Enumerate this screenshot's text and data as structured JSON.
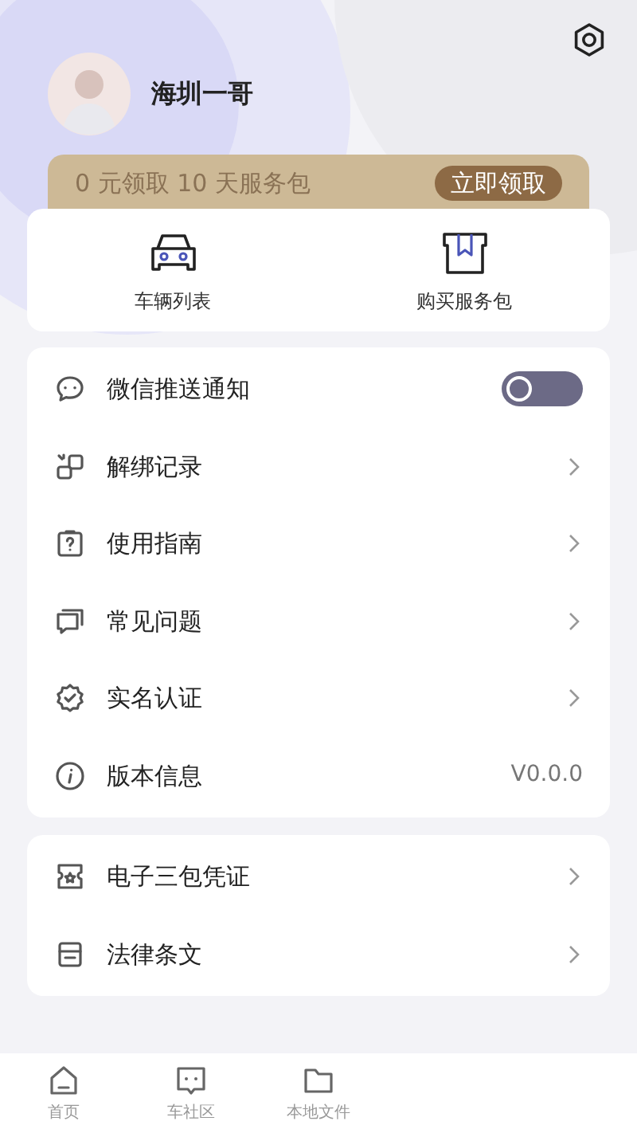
{
  "profile": {
    "name": "海圳一哥"
  },
  "promo": {
    "text": "0 元领取 10 天服务包",
    "button": "立即领取"
  },
  "shortcuts": [
    {
      "kind": "car",
      "label": "车辆列表"
    },
    {
      "kind": "package",
      "label": "购买服务包"
    }
  ],
  "menu": [
    {
      "kind": "toggle",
      "label": "微信推送通知",
      "on": false
    },
    {
      "kind": "link",
      "label": "解绑记录"
    },
    {
      "kind": "link",
      "label": "使用指南"
    },
    {
      "kind": "link",
      "label": "常见问题"
    },
    {
      "kind": "link",
      "label": "实名认证"
    },
    {
      "kind": "value",
      "label": "版本信息",
      "value": "V0.0.0"
    }
  ],
  "menu_2": [
    {
      "kind": "link",
      "label": "电子三包凭证"
    },
    {
      "kind": "link",
      "label": "法律条文"
    }
  ],
  "tab_bar": [
    {
      "label": "首页"
    },
    {
      "label": "车社区"
    },
    {
      "label": "本地文件"
    }
  ]
}
